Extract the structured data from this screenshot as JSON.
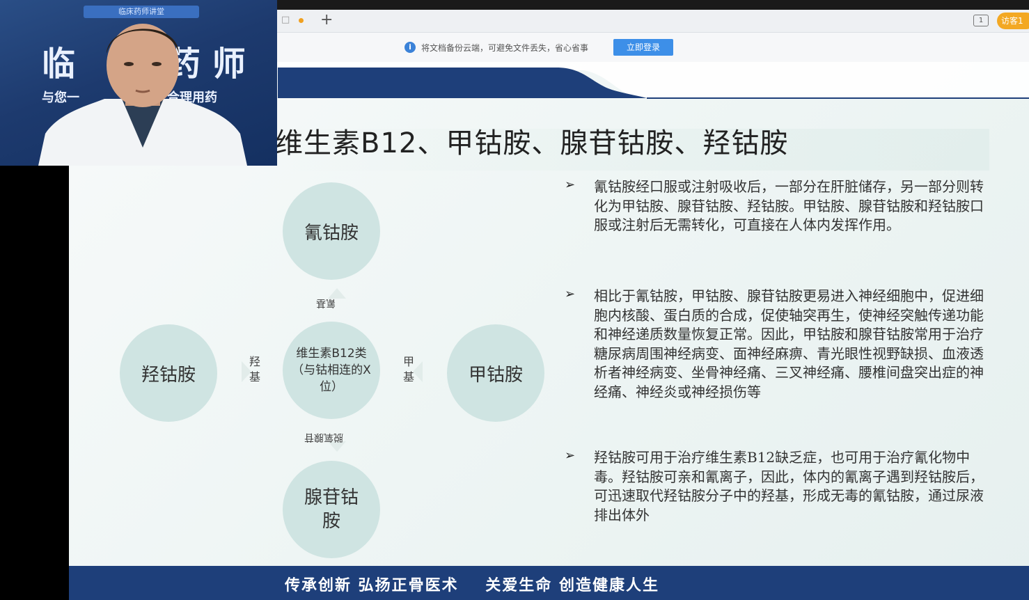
{
  "browser": {
    "new_tab_symbol": "+",
    "tab_count": "1",
    "user_chip_label": "访客1"
  },
  "notice": {
    "info_symbol": "i",
    "text": "将文档备份云端，可避免文件丢失，省心省事",
    "login_button": "立即登录"
  },
  "slide": {
    "title": "维生素B12、甲钴胺、腺苷钴胺、羟钴胺",
    "diagram": {
      "top": "氰钴胺",
      "left": "羟钴胺",
      "right": "甲钴胺",
      "bottom": "腺苷钴胺",
      "center": "维生素B12类（与钴相连的X位）",
      "label_top": "氰基",
      "label_left": "羟基",
      "label_right": "甲基",
      "label_bottom": "脱氧腺苷"
    },
    "bullets": [
      "氰钴胺经口服或注射吸收后，一部分在肝脏储存，另一部分则转化为甲钴胺、腺苷钴胺、羟钴胺。甲钴胺、腺苷钴胺和羟钴胺口服或注射后无需转化，可直接在人体内发挥作用。",
      "相比于氰钴胺，甲钴胺、腺苷钴胺更易进入神经细胞中，促进细胞内核酸、蛋白质的合成，促使轴突再生，使神经突触传递功能和神经递质数量恢复正常。因此，甲钴胺和腺苷钴胺常用于治疗糖尿病周围神经病变、面神经麻痹、青光眼性视野缺损、血液透析者神经病变、坐骨神经痛、三叉神经痛、腰椎间盘突出症的神经痛、神经炎或神经损伤等",
      "羟钴胺可用于治疗维生素B12缺乏症，也可用于治疗氰化物中毒。羟钴胺可亲和氰离子，因此，体内的氰离子遇到羟钴胺后，可迅速取代羟钴胺分子中的羟基，形成无毒的氰钴胺，通过尿液排出体外"
    ],
    "bullet_mark": "➢",
    "footer": "传承创新 弘扬正骨医术    关爱生命 创造健康人生"
  },
  "webcam": {
    "banner": "临床药师讲堂",
    "title_left": "临",
    "title_right": "药 师",
    "sub_left": "与您一",
    "sub_right": "合理用药"
  },
  "colors": {
    "footer_bg": "#1e3f7a",
    "circle_fill": "#cfe4e2",
    "login_button": "#3d8fe8",
    "user_chip": "#f3a823"
  }
}
